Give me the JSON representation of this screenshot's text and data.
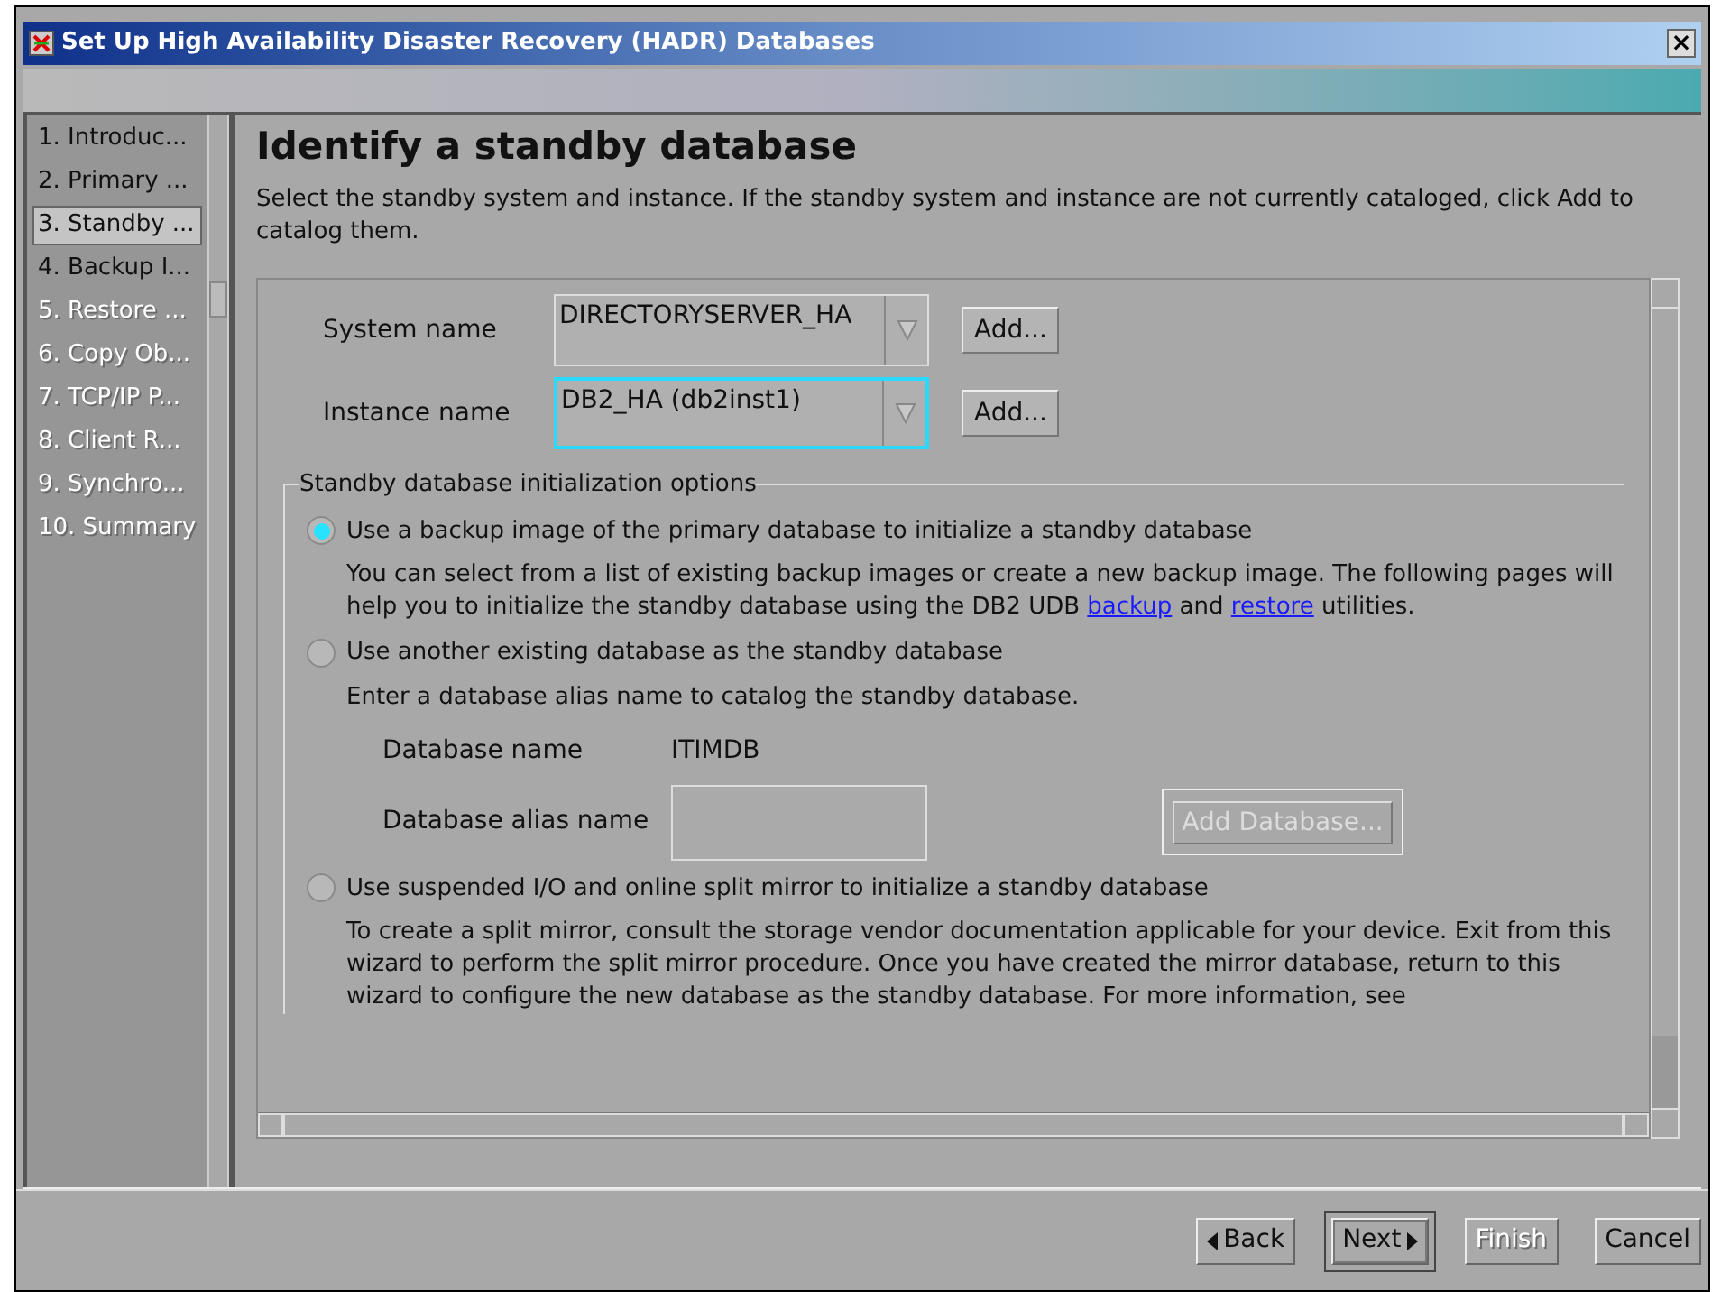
{
  "window": {
    "title": "Set Up High Availability Disaster Recovery (HADR) Databases",
    "close": "×"
  },
  "steps": [
    {
      "label": "1. Introduc...",
      "selected": false,
      "disabled": false
    },
    {
      "label": "2. Primary ...",
      "selected": false,
      "disabled": false
    },
    {
      "label": "3. Standby ...",
      "selected": true,
      "disabled": false
    },
    {
      "label": "4. Backup I...",
      "selected": false,
      "disabled": false
    },
    {
      "label": "5. Restore ...",
      "selected": false,
      "disabled": true
    },
    {
      "label": "6. Copy Ob...",
      "selected": false,
      "disabled": true
    },
    {
      "label": "7. TCP/IP P...",
      "selected": false,
      "disabled": true
    },
    {
      "label": "8. Client R...",
      "selected": false,
      "disabled": true
    },
    {
      "label": "9. Synchro...",
      "selected": false,
      "disabled": true
    },
    {
      "label": "10. Summary",
      "selected": false,
      "disabled": true
    }
  ],
  "page": {
    "heading": "Identify a standby database",
    "intro": "Select the standby system and instance. If the standby system and instance are not currently cataloged, click Add to catalog them.",
    "fields": [
      {
        "label": "System name",
        "value": "DIRECTORYSERVER_HA",
        "focused": false,
        "button": "Add..."
      },
      {
        "label": "Instance name",
        "value": "DB2_HA (db2inst1)",
        "focused": true,
        "button": "Add..."
      }
    ],
    "group_title": "Standby database initialization options",
    "options": [
      {
        "label": "Use a backup image of the primary database to initialize a standby database",
        "selected": true,
        "description": [
          {
            "kind": "text",
            "text": "You can select from a list of existing backup images or create a new backup image. The following pages will help you to initialize the standby database using the DB2 UDB "
          },
          {
            "kind": "link",
            "text": "backup"
          },
          {
            "kind": "text",
            "text": " and "
          },
          {
            "kind": "link",
            "text": "restore"
          },
          {
            "kind": "text",
            "text": " utilities."
          }
        ]
      },
      {
        "label": "Use another existing database as the standby database",
        "selected": false,
        "description": [
          {
            "kind": "text",
            "text": "Enter a database alias name to catalog the standby database."
          }
        ],
        "database_name_label": "Database name",
        "database_name": "ITIMDB",
        "alias_label": "Database alias name",
        "add_button": {
          "label": "Add Database...",
          "disabled": true
        }
      },
      {
        "label": "Use suspended I/O and online split mirror to initialize a standby database",
        "selected": false,
        "description": [
          {
            "kind": "text",
            "text": "To create a split mirror, consult the storage vendor documentation applicable for your device. Exit from this wizard to perform the split mirror procedure. Once you have created the mirror database, return to this wizard to configure the new database as the standby database. For more information, see"
          }
        ]
      }
    ]
  },
  "buttons": [
    {
      "label": "Back",
      "kind": "back",
      "disabled": false,
      "default": false
    },
    {
      "label": "Next",
      "kind": "next",
      "disabled": false,
      "default": true
    },
    {
      "label": "Finish",
      "kind": "plain",
      "disabled": true,
      "default": false
    },
    {
      "label": "Cancel",
      "kind": "plain",
      "disabled": false,
      "default": false
    }
  ]
}
